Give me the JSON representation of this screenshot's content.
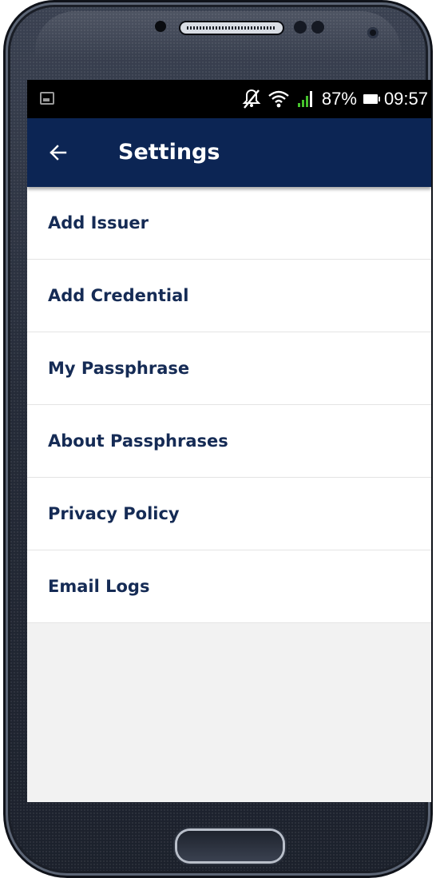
{
  "status_bar": {
    "icons": [
      "image-notification-icon",
      "mute-icon",
      "wifi-icon",
      "signal-icon",
      "battery-icon"
    ],
    "battery_percent": "87%",
    "time": "09:57"
  },
  "app_bar": {
    "back_icon": "arrow-left-icon",
    "title": "Settings"
  },
  "settings": {
    "items": [
      {
        "label": "Add Issuer"
      },
      {
        "label": "Add Credential"
      },
      {
        "label": "My Passphrase"
      },
      {
        "label": "About Passphrases"
      },
      {
        "label": "Privacy Policy"
      },
      {
        "label": "Email Logs"
      }
    ]
  },
  "colors": {
    "app_bar": "#0c2554",
    "item_text": "#152b55",
    "background": "#f2f2f2",
    "status_bar": "#000000"
  }
}
